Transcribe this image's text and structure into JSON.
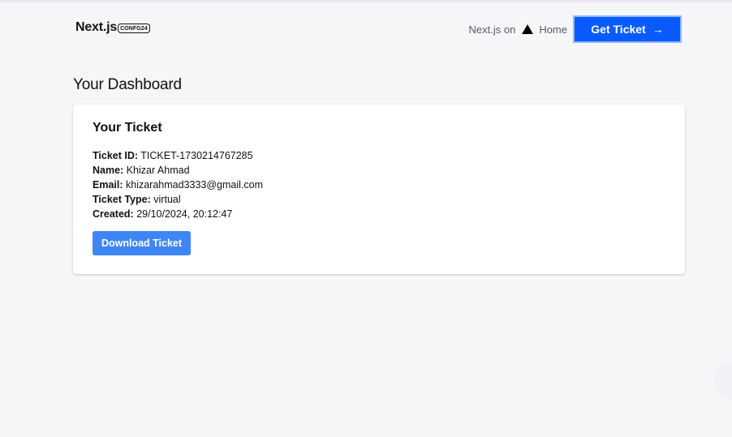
{
  "header": {
    "brand_name": "Next.js",
    "brand_badge": "CONFG24",
    "nav_text": "Next.js on",
    "vercel_icon": "triangle-logo-icon",
    "home_link": "Home",
    "get_ticket_label": "Get Ticket",
    "get_ticket_arrow": "→"
  },
  "main": {
    "title": "Your Dashboard"
  },
  "ticket": {
    "heading": "Your Ticket",
    "fields": [
      {
        "label": "Ticket ID:",
        "value": "TICKET-1730214767285"
      },
      {
        "label": "Name:",
        "value": "Khizar Ahmad"
      },
      {
        "label": "Email:",
        "value": "khizarahmad3333@gmail.com"
      },
      {
        "label": "Ticket Type:",
        "value": "virtual"
      },
      {
        "label": "Created:",
        "value": "29/10/2024, 20:12:47"
      }
    ],
    "download_label": "Download Ticket"
  },
  "colors": {
    "primary_button": "#0a5bff",
    "download_button": "#3f86f5",
    "page_background": "#f6f6f8"
  }
}
